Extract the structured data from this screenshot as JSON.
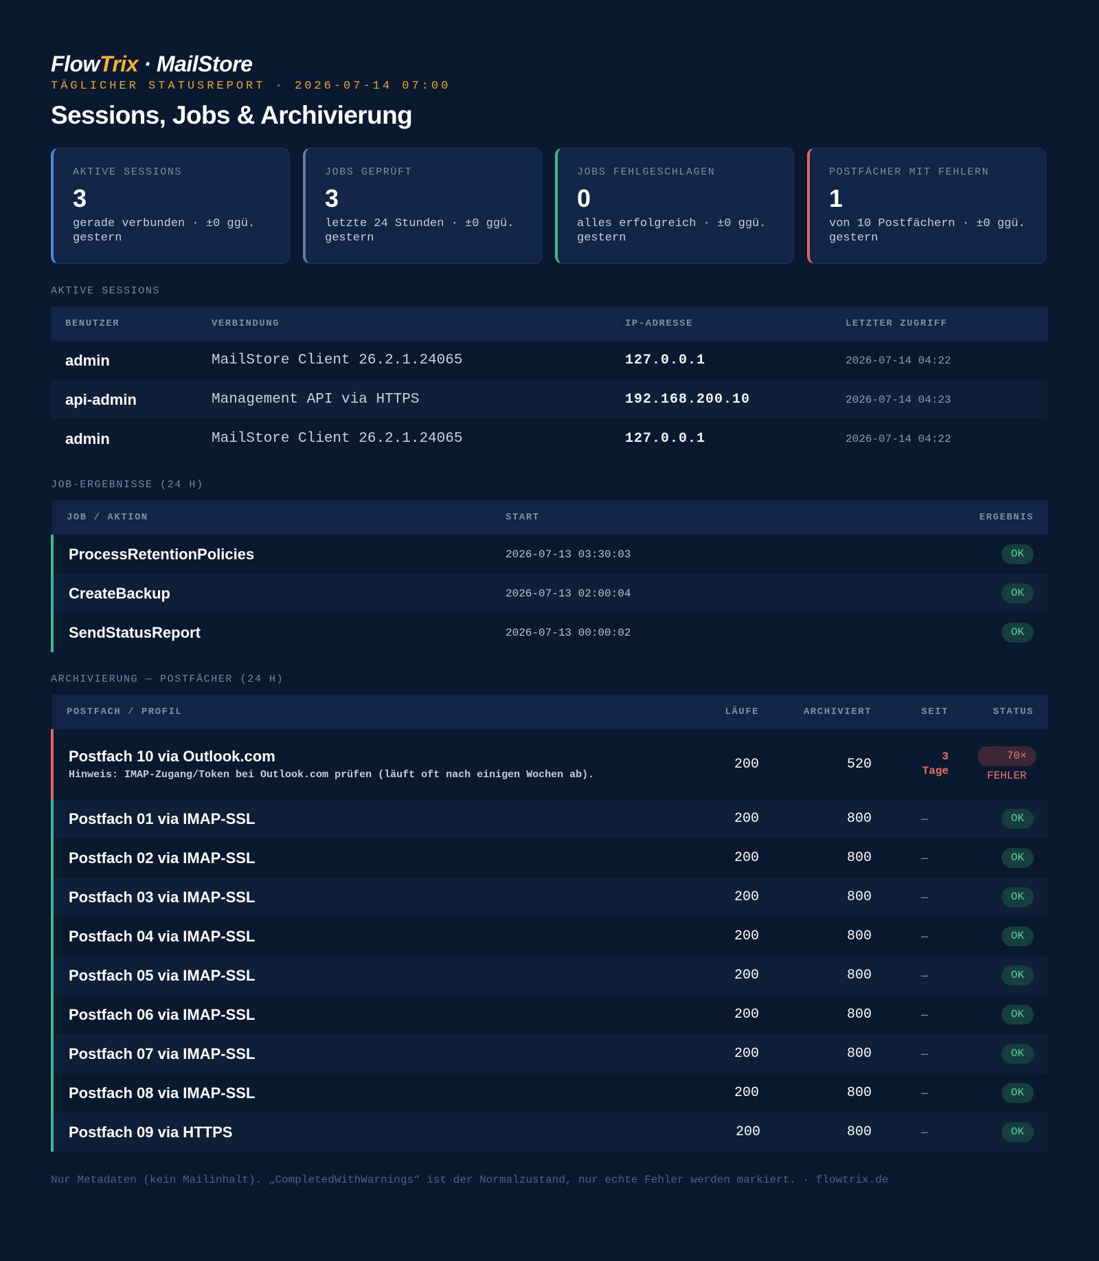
{
  "header": {
    "brand_part1": "Flow",
    "brand_part2": "Trix",
    "brand_part3": " · MailStore",
    "subtitle": "TÄGLICHER STATUSREPORT · 2026-07-14 07:00",
    "title": "Sessions, Jobs & Archivierung"
  },
  "kpis": [
    {
      "label": "AKTIVE SESSIONS",
      "value": "3",
      "sub": "gerade verbunden · ±0 ggü. gestern",
      "accent": "#4a8ad4"
    },
    {
      "label": "JOBS GEPRÜFT",
      "value": "3",
      "sub": "letzte 24 Stunden · ±0 ggü. gestern",
      "accent": "#5a7ea8"
    },
    {
      "label": "JOBS FEHLGESCHLAGEN",
      "value": "0",
      "sub": "alles erfolgreich · ±0 ggü. gestern",
      "accent": "#3fb98a"
    },
    {
      "label": "POSTFÄCHER MIT FEHLERN",
      "value": "1",
      "sub": "von 10 Postfächern · ±0 ggü. gestern",
      "accent": "#e0665e"
    }
  ],
  "sessions": {
    "label": "AKTIVE SESSIONS",
    "columns": [
      "BENUTZER",
      "VERBINDUNG",
      "IP-ADRESSE",
      "LETZTER ZUGRIFF"
    ],
    "rows": [
      {
        "user": "admin",
        "connection": "MailStore Client 26.2.1.24065",
        "ip": "127.0.0.1",
        "last": "2026-07-14 04:22"
      },
      {
        "user": "api-admin",
        "connection": "Management API via HTTPS",
        "ip": "192.168.200.10",
        "last": "2026-07-14 04:23"
      },
      {
        "user": "admin",
        "connection": "MailStore Client 26.2.1.24065",
        "ip": "127.0.0.1",
        "last": "2026-07-14 04:22"
      }
    ]
  },
  "jobs": {
    "label": "JOB-ERGEBNISSE (24 H)",
    "columns": [
      "JOB / AKTION",
      "START",
      "ERGEBNIS"
    ],
    "rows": [
      {
        "name": "ProcessRetentionPolicies",
        "start": "2026-07-13 03:30:03",
        "result": "OK"
      },
      {
        "name": "CreateBackup",
        "start": "2026-07-13 02:00:04",
        "result": "OK"
      },
      {
        "name": "SendStatusReport",
        "start": "2026-07-13 00:00:02",
        "result": "OK"
      }
    ]
  },
  "archive": {
    "label": "ARCHIVIERUNG — POSTFÄCHER (24 H)",
    "columns": [
      "POSTFACH / PROFIL",
      "LÄUFE",
      "ARCHIVIERT",
      "SEIT",
      "STATUS"
    ],
    "error_row": {
      "name": "Postfach 10 via Outlook.com",
      "hint": "Hinweis: IMAP-Zugang/Token bei Outlook.com prüfen (läuft oft nach einigen Wochen ab).",
      "runs": "200",
      "archived": "520",
      "since_num": "3",
      "since_unit": "Tage",
      "status": "70× FEHLER"
    },
    "rows": [
      {
        "name": "Postfach 01 via IMAP-SSL",
        "runs": "200",
        "archived": "800",
        "since": "–",
        "status": "OK"
      },
      {
        "name": "Postfach 02 via IMAP-SSL",
        "runs": "200",
        "archived": "800",
        "since": "–",
        "status": "OK"
      },
      {
        "name": "Postfach 03 via IMAP-SSL",
        "runs": "200",
        "archived": "800",
        "since": "–",
        "status": "OK"
      },
      {
        "name": "Postfach 04 via IMAP-SSL",
        "runs": "200",
        "archived": "800",
        "since": "–",
        "status": "OK"
      },
      {
        "name": "Postfach 05 via IMAP-SSL",
        "runs": "200",
        "archived": "800",
        "since": "–",
        "status": "OK"
      },
      {
        "name": "Postfach 06 via IMAP-SSL",
        "runs": "200",
        "archived": "800",
        "since": "–",
        "status": "OK"
      },
      {
        "name": "Postfach 07 via IMAP-SSL",
        "runs": "200",
        "archived": "800",
        "since": "–",
        "status": "OK"
      },
      {
        "name": "Postfach 08 via IMAP-SSL",
        "runs": "200",
        "archived": "800",
        "since": "–",
        "status": "OK"
      },
      {
        "name": "Postfach 09 via HTTPS",
        "runs": "200",
        "archived": "800",
        "since": "–",
        "status": "OK"
      }
    ]
  },
  "footer": "Nur Metadaten (kein Mailinhalt). „CompletedWithWarnings“ ist der Normalzustand, nur echte Fehler werden markiert. · flowtrix.de"
}
